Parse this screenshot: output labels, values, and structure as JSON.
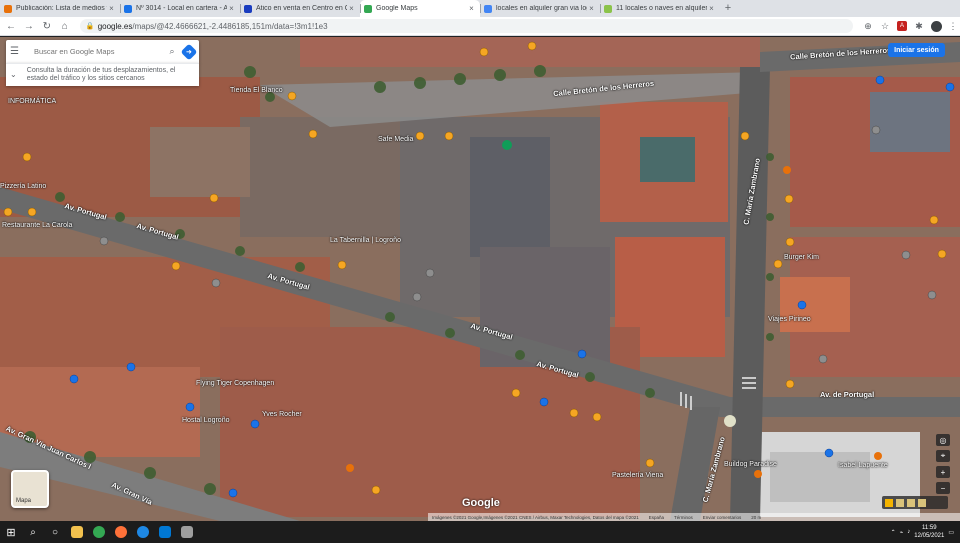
{
  "browser": {
    "tabs": [
      {
        "title": "Publicación: Lista de medios for",
        "color": "#e8710a",
        "active": false
      },
      {
        "title": "Nº 3014 - Local en cartera - Alqu",
        "color": "#1a73e8",
        "active": false
      },
      {
        "title": "Ático en venta en Centro en Ce…",
        "color": "#1a3dbf",
        "active": false
      },
      {
        "title": "Google Maps",
        "color": "#34a853",
        "active": true
      },
      {
        "title": "locales en alquiler gran via logro",
        "color": "#4285f4",
        "active": false
      },
      {
        "title": "11 locales o naves en alquiler en",
        "color": "#8bc34a",
        "active": false
      }
    ],
    "new_tab": "+",
    "close_glyph": "×",
    "url_host": "google.es",
    "url_rest": "/maps/@42.4666621,-2.4486185,151m/data=!3m1!1e3",
    "icons": [
      "back-icon",
      "forward-icon",
      "reload-icon",
      "home-icon",
      "lock-icon",
      "share-icon",
      "star-icon",
      "adobe-icon",
      "extensions-icon",
      "profile-icon",
      "more-icon"
    ]
  },
  "maps": {
    "search_placeholder": "Buscar en Google Maps",
    "commute_text": "Consulta la duración de tus desplazamientos, el estado del tráfico y los sitios cercanos",
    "signin_label": "Iniciar sesión",
    "layer_label": "Mapa",
    "logo": "Google",
    "attribution": [
      "Imágenes ©2021 Google,Imágenes ©2021 CNES / Airbus, Maxar Technologies, Datos del mapa ©2021",
      "España",
      "Términos",
      "Enviar comentarios",
      "20 m"
    ],
    "streets": [
      "Calle Bretón de los Herreros",
      "Calle Bretón de los Herreros",
      "Av. Portugal",
      "Av. Portugal",
      "Av. Portugal",
      "Av. Portugal",
      "Av. Portugal",
      "Av. de Portugal",
      "C. María Zambrano",
      "C. María Zambrano",
      "Av. Gran Vía Juan Carlos I",
      "Av. Gran Vía"
    ],
    "pois": [
      "INFORMÁTICA",
      "Tienda El Blanco",
      "Safe Media",
      "Pizzería Latino",
      "Restaurante La Carola",
      "La Tabernilla | Logroño",
      "Flying Tiger Copenhagen",
      "Yves Rocher",
      "Hostal Logroño",
      "Buildog Paradise",
      "Viajes Pirineo",
      "Burger Kim",
      "Isabel Lapuente",
      "Pastelería Viena"
    ]
  },
  "taskbar": {
    "search_glyph": "⌕",
    "time": "11:59",
    "date": "12/05/2021"
  }
}
